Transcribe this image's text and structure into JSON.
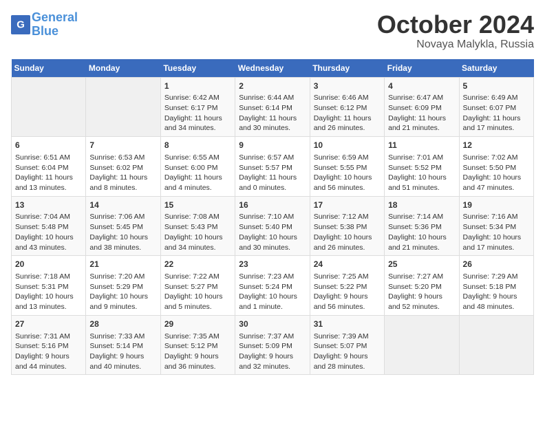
{
  "header": {
    "logo_line1": "General",
    "logo_line2": "Blue",
    "month": "October 2024",
    "location": "Novaya Malykla, Russia"
  },
  "days_of_week": [
    "Sunday",
    "Monday",
    "Tuesday",
    "Wednesday",
    "Thursday",
    "Friday",
    "Saturday"
  ],
  "weeks": [
    [
      {
        "day": "",
        "info": ""
      },
      {
        "day": "",
        "info": ""
      },
      {
        "day": "1",
        "info": "Sunrise: 6:42 AM\nSunset: 6:17 PM\nDaylight: 11 hours and 34 minutes."
      },
      {
        "day": "2",
        "info": "Sunrise: 6:44 AM\nSunset: 6:14 PM\nDaylight: 11 hours and 30 minutes."
      },
      {
        "day": "3",
        "info": "Sunrise: 6:46 AM\nSunset: 6:12 PM\nDaylight: 11 hours and 26 minutes."
      },
      {
        "day": "4",
        "info": "Sunrise: 6:47 AM\nSunset: 6:09 PM\nDaylight: 11 hours and 21 minutes."
      },
      {
        "day": "5",
        "info": "Sunrise: 6:49 AM\nSunset: 6:07 PM\nDaylight: 11 hours and 17 minutes."
      }
    ],
    [
      {
        "day": "6",
        "info": "Sunrise: 6:51 AM\nSunset: 6:04 PM\nDaylight: 11 hours and 13 minutes."
      },
      {
        "day": "7",
        "info": "Sunrise: 6:53 AM\nSunset: 6:02 PM\nDaylight: 11 hours and 8 minutes."
      },
      {
        "day": "8",
        "info": "Sunrise: 6:55 AM\nSunset: 6:00 PM\nDaylight: 11 hours and 4 minutes."
      },
      {
        "day": "9",
        "info": "Sunrise: 6:57 AM\nSunset: 5:57 PM\nDaylight: 11 hours and 0 minutes."
      },
      {
        "day": "10",
        "info": "Sunrise: 6:59 AM\nSunset: 5:55 PM\nDaylight: 10 hours and 56 minutes."
      },
      {
        "day": "11",
        "info": "Sunrise: 7:01 AM\nSunset: 5:52 PM\nDaylight: 10 hours and 51 minutes."
      },
      {
        "day": "12",
        "info": "Sunrise: 7:02 AM\nSunset: 5:50 PM\nDaylight: 10 hours and 47 minutes."
      }
    ],
    [
      {
        "day": "13",
        "info": "Sunrise: 7:04 AM\nSunset: 5:48 PM\nDaylight: 10 hours and 43 minutes."
      },
      {
        "day": "14",
        "info": "Sunrise: 7:06 AM\nSunset: 5:45 PM\nDaylight: 10 hours and 38 minutes."
      },
      {
        "day": "15",
        "info": "Sunrise: 7:08 AM\nSunset: 5:43 PM\nDaylight: 10 hours and 34 minutes."
      },
      {
        "day": "16",
        "info": "Sunrise: 7:10 AM\nSunset: 5:40 PM\nDaylight: 10 hours and 30 minutes."
      },
      {
        "day": "17",
        "info": "Sunrise: 7:12 AM\nSunset: 5:38 PM\nDaylight: 10 hours and 26 minutes."
      },
      {
        "day": "18",
        "info": "Sunrise: 7:14 AM\nSunset: 5:36 PM\nDaylight: 10 hours and 21 minutes."
      },
      {
        "day": "19",
        "info": "Sunrise: 7:16 AM\nSunset: 5:34 PM\nDaylight: 10 hours and 17 minutes."
      }
    ],
    [
      {
        "day": "20",
        "info": "Sunrise: 7:18 AM\nSunset: 5:31 PM\nDaylight: 10 hours and 13 minutes."
      },
      {
        "day": "21",
        "info": "Sunrise: 7:20 AM\nSunset: 5:29 PM\nDaylight: 10 hours and 9 minutes."
      },
      {
        "day": "22",
        "info": "Sunrise: 7:22 AM\nSunset: 5:27 PM\nDaylight: 10 hours and 5 minutes."
      },
      {
        "day": "23",
        "info": "Sunrise: 7:23 AM\nSunset: 5:24 PM\nDaylight: 10 hours and 1 minute."
      },
      {
        "day": "24",
        "info": "Sunrise: 7:25 AM\nSunset: 5:22 PM\nDaylight: 9 hours and 56 minutes."
      },
      {
        "day": "25",
        "info": "Sunrise: 7:27 AM\nSunset: 5:20 PM\nDaylight: 9 hours and 52 minutes."
      },
      {
        "day": "26",
        "info": "Sunrise: 7:29 AM\nSunset: 5:18 PM\nDaylight: 9 hours and 48 minutes."
      }
    ],
    [
      {
        "day": "27",
        "info": "Sunrise: 7:31 AM\nSunset: 5:16 PM\nDaylight: 9 hours and 44 minutes."
      },
      {
        "day": "28",
        "info": "Sunrise: 7:33 AM\nSunset: 5:14 PM\nDaylight: 9 hours and 40 minutes."
      },
      {
        "day": "29",
        "info": "Sunrise: 7:35 AM\nSunset: 5:12 PM\nDaylight: 9 hours and 36 minutes."
      },
      {
        "day": "30",
        "info": "Sunrise: 7:37 AM\nSunset: 5:09 PM\nDaylight: 9 hours and 32 minutes."
      },
      {
        "day": "31",
        "info": "Sunrise: 7:39 AM\nSunset: 5:07 PM\nDaylight: 9 hours and 28 minutes."
      },
      {
        "day": "",
        "info": ""
      },
      {
        "day": "",
        "info": ""
      }
    ]
  ]
}
